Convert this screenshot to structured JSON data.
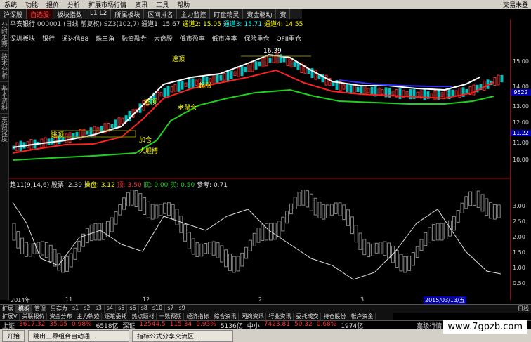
{
  "menu": [
    "系统",
    "功能",
    "报价",
    "分析",
    "扩展市场行情",
    "资讯",
    "工具",
    "帮助"
  ],
  "menu_brand": "交易未登",
  "tabs": [
    "沪深股",
    "自选股",
    "板块指数",
    "L1 L2",
    "所属板块",
    "区间排名",
    "主力监控",
    "盯盘精灵",
    "资金驱动",
    "资"
  ],
  "active_tab": 1,
  "sidebar": [
    "分时走势",
    "技术分析",
    "基本资料",
    "东财深度"
  ],
  "info": {
    "name": "平安银行",
    "code": "000001",
    "period": "(日线 前复权)",
    "sz3": "SZ3(102,7)",
    "ma1_label": "通道1: 15.67",
    "ma2_label": "通道2: 15.05",
    "ma3_label": "通道3: 15.71",
    "ma4_label": "通道4: 14.55"
  },
  "concepts": [
    "深圳板块",
    "银行",
    "通达信88",
    "珠三角",
    "融资融券",
    "大盘股",
    "低市盈率",
    "低市净率",
    "保险重仓",
    "QFII重仓"
  ],
  "annotations": [
    "逃顶",
    "逃顶",
    "逃顶",
    "起涨",
    "老鼠仓",
    "加仓",
    "大胆搏"
  ],
  "peak_label": "16.39",
  "y_ticks": [
    "15.00",
    "14.00",
    "13.00",
    "12.00",
    "11.00",
    "10.00"
  ],
  "price_box1": "9622",
  "price_box2": "11.22",
  "ind_ticks": [
    "3.00",
    "2.50",
    "2.00",
    "1.50",
    "1.00",
    "0.50"
  ],
  "indicator": {
    "name": "趋11(9,14,6)",
    "f1": "股票: 2.39",
    "f2": "操盘: 3.12",
    "f3": "顶: 3.50",
    "f4": "底: 0.00",
    "f5": "买: 0.50",
    "f6": "参考: 0.71"
  },
  "dates": [
    "2014年",
    "11",
    "12",
    "2",
    "3",
    "2015/03/13/五"
  ],
  "bottom_tabs": [
    "扩展",
    "模板",
    "管理",
    "另存为",
    "s1",
    "s2",
    "s3",
    "s4",
    "s5",
    "s6",
    "s8",
    "s10",
    "s7",
    "s9"
  ],
  "bottom_right": "日线",
  "func_tabs": [
    "扩展V",
    "关联报价",
    "资金分布",
    "主力轨迹",
    "逐笔委托",
    "热点题材",
    "一数预期",
    "经济指标",
    "综合资讯",
    "网摘资讯",
    "行业资讯",
    "委托成交",
    "持仓股份",
    "帐户资金"
  ],
  "index_bar": [
    {
      "label": "上证",
      "val": "3617.32",
      "chg": "35.05",
      "pct": "0.98%",
      "amt": "6518亿"
    },
    {
      "label": "深证",
      "val": "12544.5",
      "chg": "115.34",
      "pct": "0.93%",
      "amt": "5136亿"
    },
    {
      "label": "中小",
      "val": "7423.81",
      "chg": "50.32",
      "pct": "0.68%",
      "amt": "1974亿"
    }
  ],
  "index_right": "嘉级行情",
  "taskbar": {
    "start": "开始",
    "task1": "跳出三界组合自动通...",
    "task2": "指标公式分享交流区..."
  },
  "watermark": "www.7gpzb.com"
}
